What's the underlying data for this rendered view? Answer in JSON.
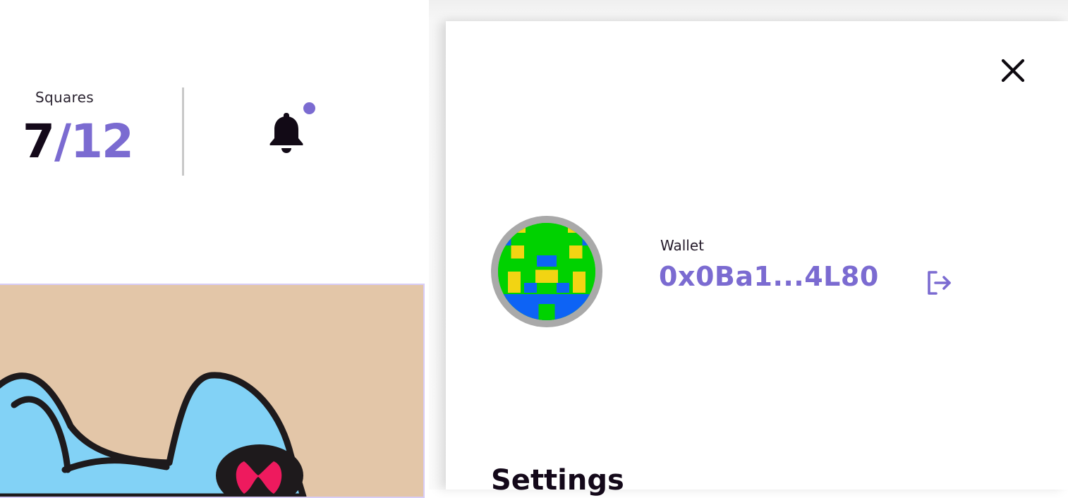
{
  "stats": {
    "squares_label": "Squares",
    "squares_owned": "7",
    "squares_separator": "/",
    "squares_total": "12"
  },
  "notifications": {
    "icon": "bell-icon",
    "has_unread": true
  },
  "drawer": {
    "close_icon": "close-icon",
    "wallet": {
      "label": "Wallet",
      "address": "0x0Ba1...4L80",
      "logout_icon": "logout-icon"
    },
    "settings_title": "Settings"
  },
  "colors": {
    "accent": "#7b6bd1",
    "text_dark": "#14091a",
    "artwork_bg": "#e3c6a8",
    "avatar_ring": "#a9a9a9",
    "avatar_green": "#00d200",
    "avatar_blue": "#0d63f5",
    "avatar_yellow": "#f2d413"
  }
}
